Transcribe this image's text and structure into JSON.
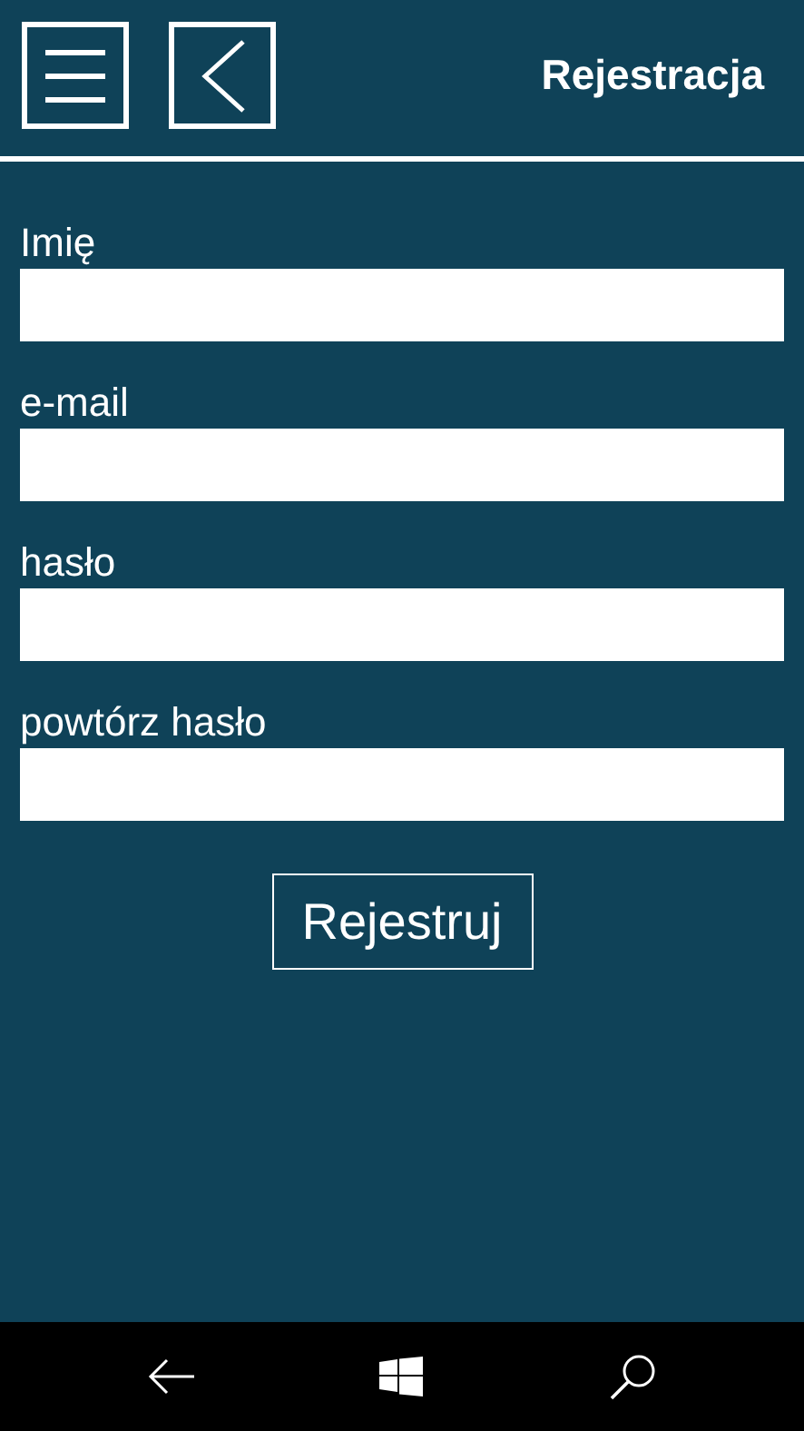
{
  "header": {
    "title": "Rejestracja"
  },
  "fields": [
    {
      "label": "Imię"
    },
    {
      "label": "e-mail"
    },
    {
      "label": "hasło"
    },
    {
      "label": "powtórz hasło"
    }
  ],
  "submit_button": "Rejestruj"
}
